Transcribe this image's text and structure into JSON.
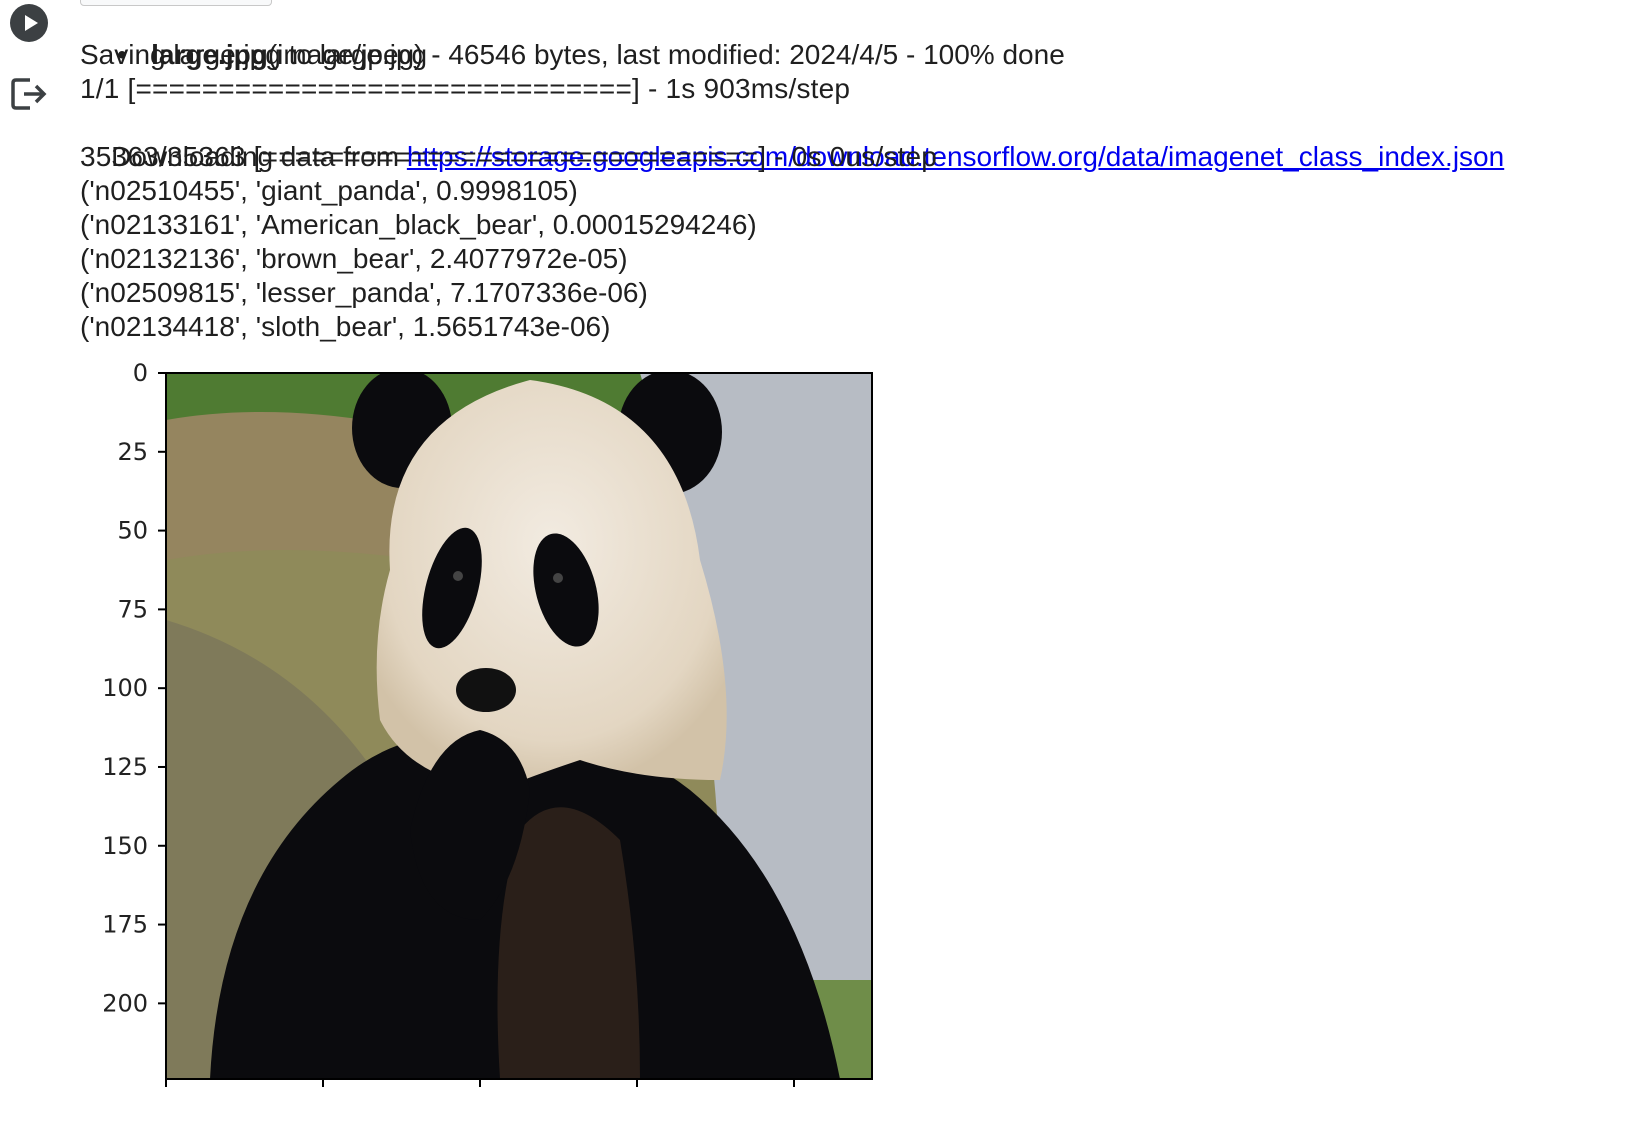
{
  "upload": {
    "bullet": "•",
    "filename": "large.jpg",
    "details": "(image/jpeg) - 46546 bytes, last modified: 2024/4/5 - 100% done"
  },
  "output_lines": {
    "saving": "Saving large.jpg to large.jpg",
    "progress1": "1/1 [==============================] - 1s 903ms/step",
    "downloading_prefix": "Downloading data from ",
    "download_url": "https://storage.googleapis.com/download.tensorflow.org/data/imagenet_class_index.json",
    "progress2": "35363/35363 [==============================] - 0s 0us/step"
  },
  "predictions": [
    "('n02510455', 'giant_panda', 0.9998105)",
    "('n02133161', 'American_black_bear', 0.00015294246)",
    "('n02132136', 'brown_bear', 2.4077972e-05)",
    "('n02509815', 'lesser_panda', 7.1707336e-06)",
    "('n02134418', 'sloth_bear', 1.5651743e-06)"
  ],
  "plot": {
    "yticks": [
      "0",
      "25",
      "50",
      "75",
      "100",
      "125",
      "150",
      "175",
      "200"
    ],
    "colors": {
      "background": "#8f8a5a",
      "grass": "#4f7b32",
      "rock": "#b7bcc4",
      "black_fur": "#0b0b0e",
      "white_fur": "#ece3d6"
    }
  },
  "icons": {
    "run": "play-circle-icon",
    "output": "output-exit-icon"
  }
}
